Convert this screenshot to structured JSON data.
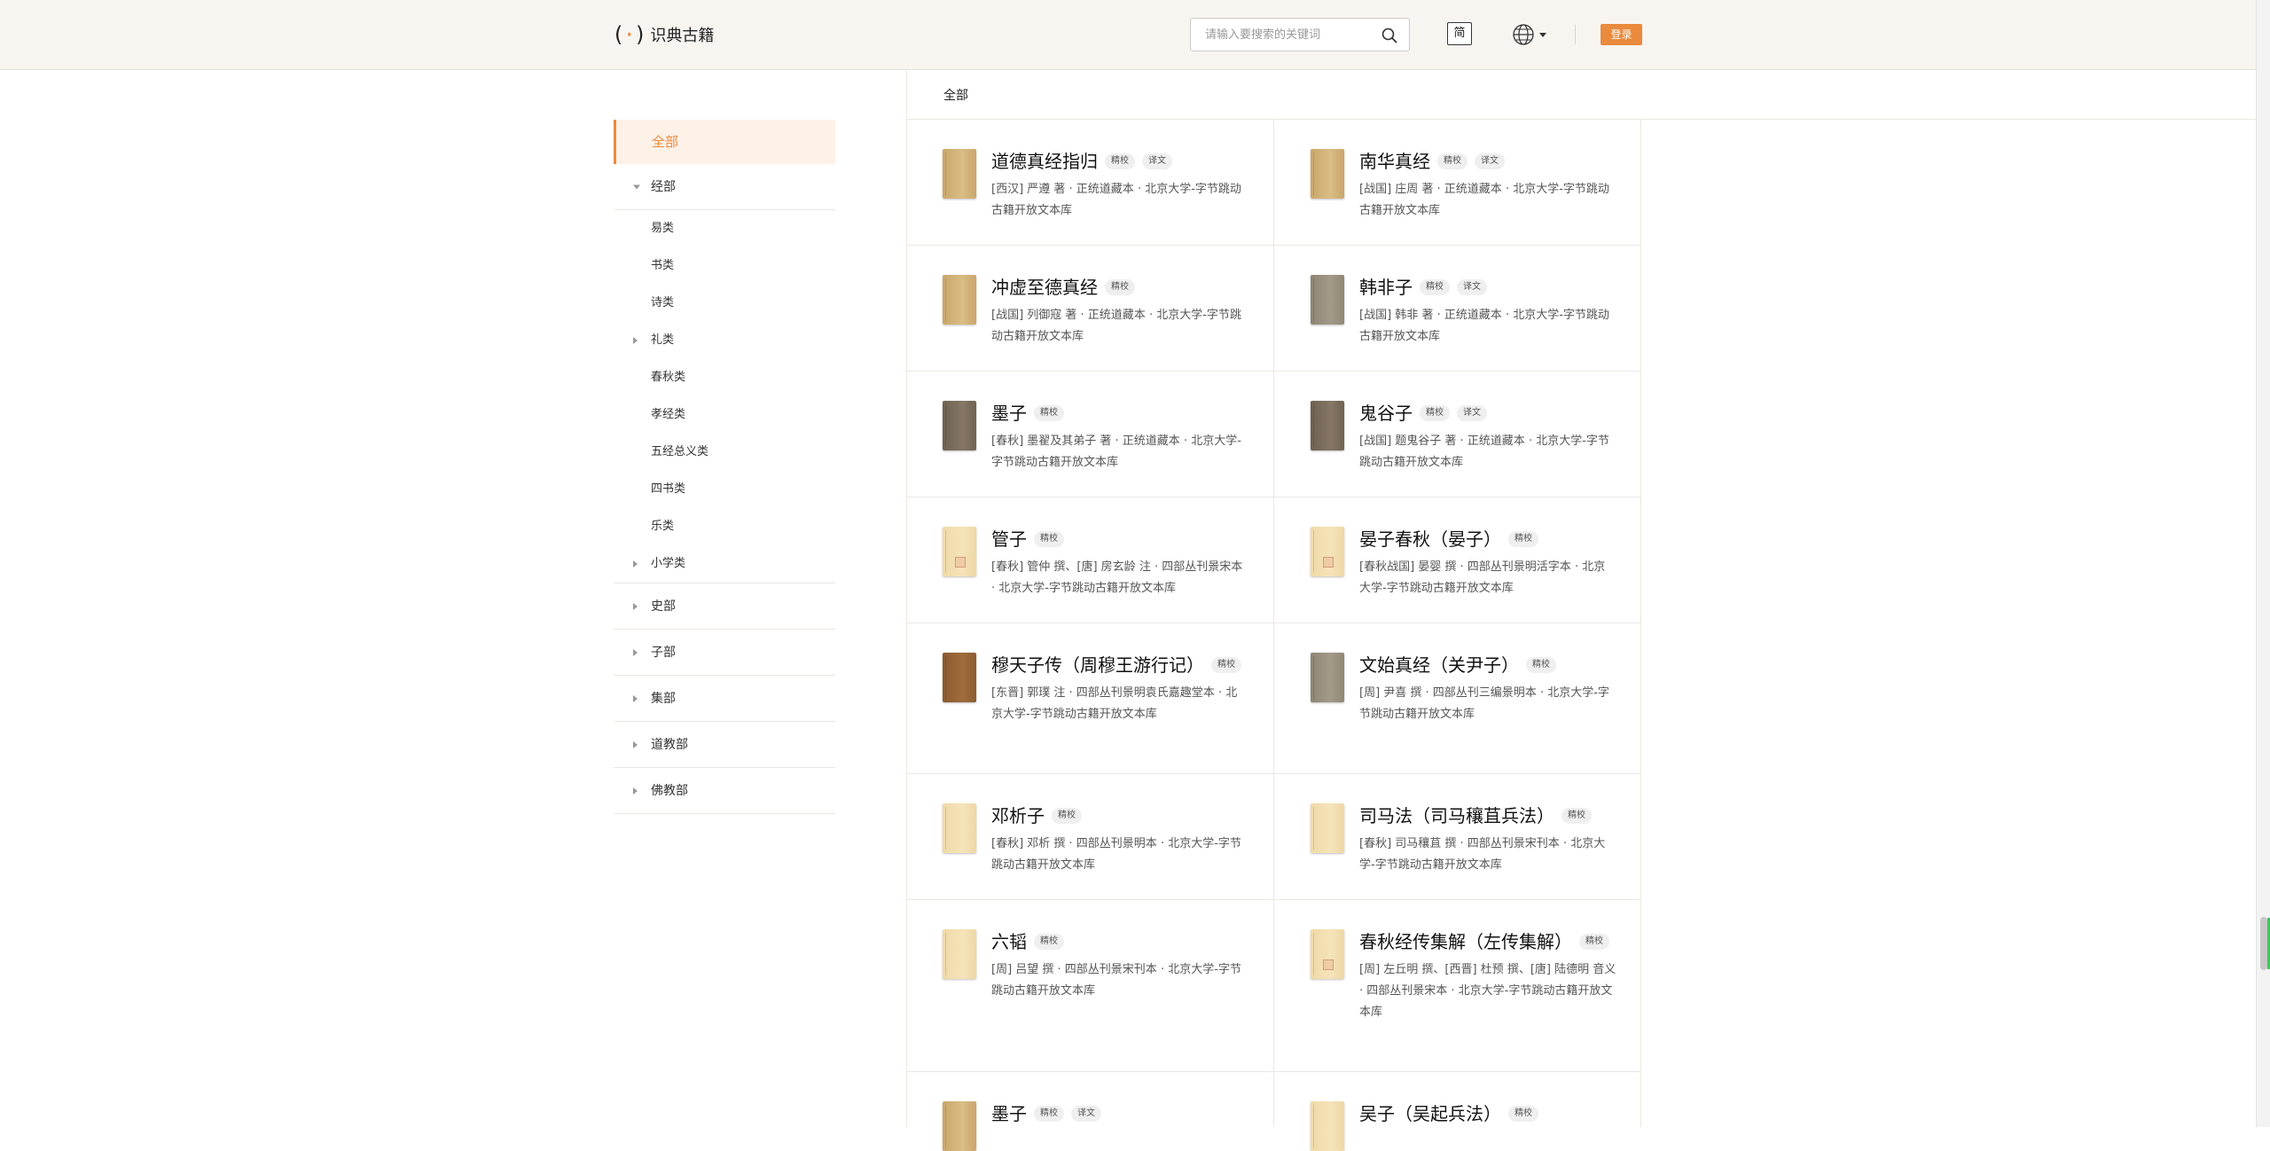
{
  "header": {
    "logo_mark": "( )",
    "logo_text": "识典古籍",
    "search_placeholder": "请输入要搜索的关键词",
    "lang_label": "简",
    "login_label": "登录"
  },
  "sidebar": {
    "all_label": "全部",
    "jing_label": "经部",
    "jing_items": [
      "易类",
      "书类",
      "诗类",
      "礼类",
      "春秋类",
      "孝经类",
      "五经总义类",
      "四书类",
      "乐类",
      "小学类"
    ],
    "shi_label": "史部",
    "zi_label": "子部",
    "ji_label": "集部",
    "dao_label": "道教部",
    "fo_label": "佛教部"
  },
  "content": {
    "breadcrumb": "全部",
    "books": [
      {
        "title": "道德真经指归",
        "tags": [
          "精校",
          "译文"
        ],
        "meta": "[西汉] 严遵 著 · 正统道藏本 · 北京大学-字节跳动古籍开放文本库"
      },
      {
        "title": "南华真经",
        "tags": [
          "精校",
          "译文"
        ],
        "meta": "[战国] 庄周 著 · 正统道藏本 · 北京大学-字节跳动古籍开放文本库"
      },
      {
        "title": "冲虚至德真经",
        "tags": [
          "精校"
        ],
        "meta": "[战国] 列御寇 著 · 正统道藏本 · 北京大学-字节跳动古籍开放文本库"
      },
      {
        "title": "韩非子",
        "tags": [
          "精校",
          "译文"
        ],
        "meta": "[战国] 韩非 著 · 正统道藏本 · 北京大学-字节跳动古籍开放文本库"
      },
      {
        "title": "墨子",
        "tags": [
          "精校"
        ],
        "meta": "[春秋] 墨翟及其弟子 著 · 正统道藏本 · 北京大学-字节跳动古籍开放文本库"
      },
      {
        "title": "鬼谷子",
        "tags": [
          "精校",
          "译文"
        ],
        "meta": "[战国] 题鬼谷子 著 · 正统道藏本 · 北京大学-字节跳动古籍开放文本库"
      },
      {
        "title": "管子",
        "tags": [
          "精校"
        ],
        "meta": "[春秋] 管仲 撰、[唐] 房玄龄 注 · 四部丛刊景宋本 · 北京大学-字节跳动古籍开放文本库"
      },
      {
        "title": "晏子春秋（晏子）",
        "tags": [
          "精校"
        ],
        "meta": "[春秋战国] 晏婴 撰 · 四部丛刊景明活字本 · 北京大学-字节跳动古籍开放文本库"
      },
      {
        "title": "穆天子传（周穆王游行记）",
        "tags": [
          "精校"
        ],
        "meta": "[东晋] 郭璞 注 · 四部丛刊景明袁氏嘉趣堂本 · 北京大学-字节跳动古籍开放文本库"
      },
      {
        "title": "文始真经（关尹子）",
        "tags": [
          "精校"
        ],
        "meta": "[周] 尹喜 撰 · 四部丛刊三编景明本 · 北京大学-字节跳动古籍开放文本库"
      },
      {
        "title": "邓析子",
        "tags": [
          "精校"
        ],
        "meta": "[春秋] 邓析 撰 · 四部丛刊景明本 · 北京大学-字节跳动古籍开放文本库"
      },
      {
        "title": "司马法（司马穰苴兵法）",
        "tags": [
          "精校"
        ],
        "meta": "[春秋] 司马穰苴 撰 · 四部丛刊景宋刊本 · 北京大学-字节跳动古籍开放文本库"
      },
      {
        "title": "六韬",
        "tags": [
          "精校"
        ],
        "meta": "[周] 吕望 撰 · 四部丛刊景宋刊本 · 北京大学-字节跳动古籍开放文本库"
      },
      {
        "title": "春秋经传集解（左传集解）",
        "tags": [
          "精校"
        ],
        "meta": "[周] 左丘明 撰、[西晋] 杜预 撰、[唐] 陆德明 音义 · 四部丛刊景宋本 · 北京大学-字节跳动古籍开放文本库"
      },
      {
        "title": "墨子",
        "tags": [
          "精校",
          "译文"
        ],
        "meta": ""
      },
      {
        "title": "吴子（吴起兵法）",
        "tags": [
          "精校"
        ],
        "meta": ""
      }
    ]
  }
}
